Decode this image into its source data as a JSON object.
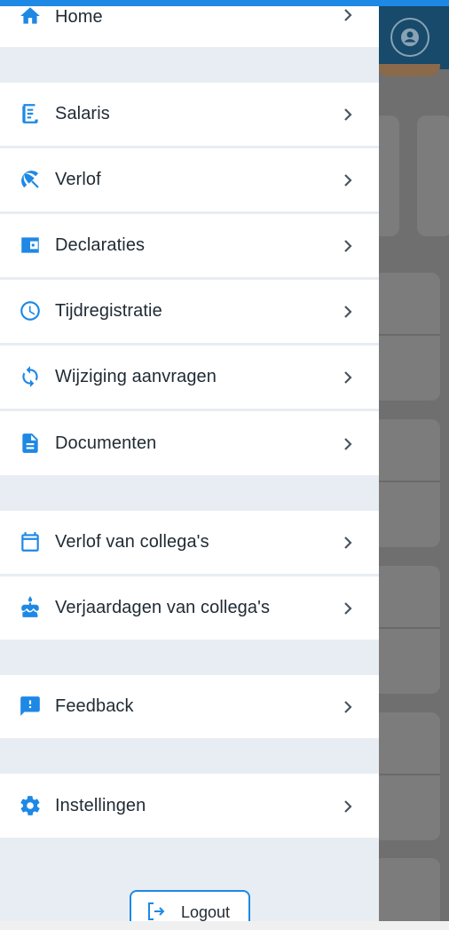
{
  "menu": {
    "items": [
      {
        "label": "Home",
        "icon": "home-icon"
      },
      {
        "label": "Salaris",
        "icon": "receipt-icon"
      },
      {
        "label": "Verlof",
        "icon": "beach-umbrella-icon"
      },
      {
        "label": "Declaraties",
        "icon": "wallet-icon"
      },
      {
        "label": "Tijdregistratie",
        "icon": "clock-icon"
      },
      {
        "label": "Wijziging aanvragen",
        "icon": "sync-icon"
      },
      {
        "label": "Documenten",
        "icon": "document-icon"
      },
      {
        "label": "Verlof van collega's",
        "icon": "calendar-icon"
      },
      {
        "label": "Verjaardagen van collega's",
        "icon": "cake-icon"
      },
      {
        "label": "Feedback",
        "icon": "feedback-icon"
      },
      {
        "label": "Instellingen",
        "icon": "gear-icon"
      }
    ],
    "logout_label": "Logout"
  },
  "colors": {
    "accent": "#1e88e5",
    "drawer_bg": "#e8edf3",
    "item_bg": "#ffffff",
    "text": "#1f2a33",
    "header_bg": "#174a6b"
  }
}
